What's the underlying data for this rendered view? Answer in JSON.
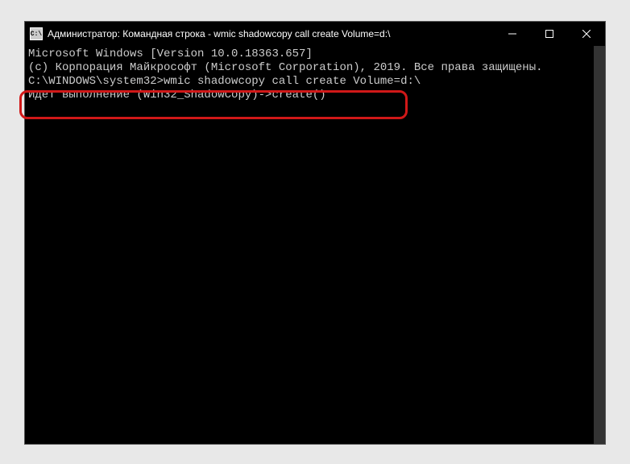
{
  "window": {
    "title": "Администратор: Командная строка - wmic  shadowcopy call create Volume=d:\\",
    "icon_label": "C:\\"
  },
  "terminal": {
    "lines": [
      "Microsoft Windows [Version 10.0.18363.657]",
      "(c) Корпорация Майкрософт (Microsoft Corporation), 2019. Все права защищены.",
      "",
      "C:\\WINDOWS\\system32>wmic shadowcopy call create Volume=d:\\",
      "Идет выполнение (Win32_ShadowCopy)->create()"
    ]
  }
}
